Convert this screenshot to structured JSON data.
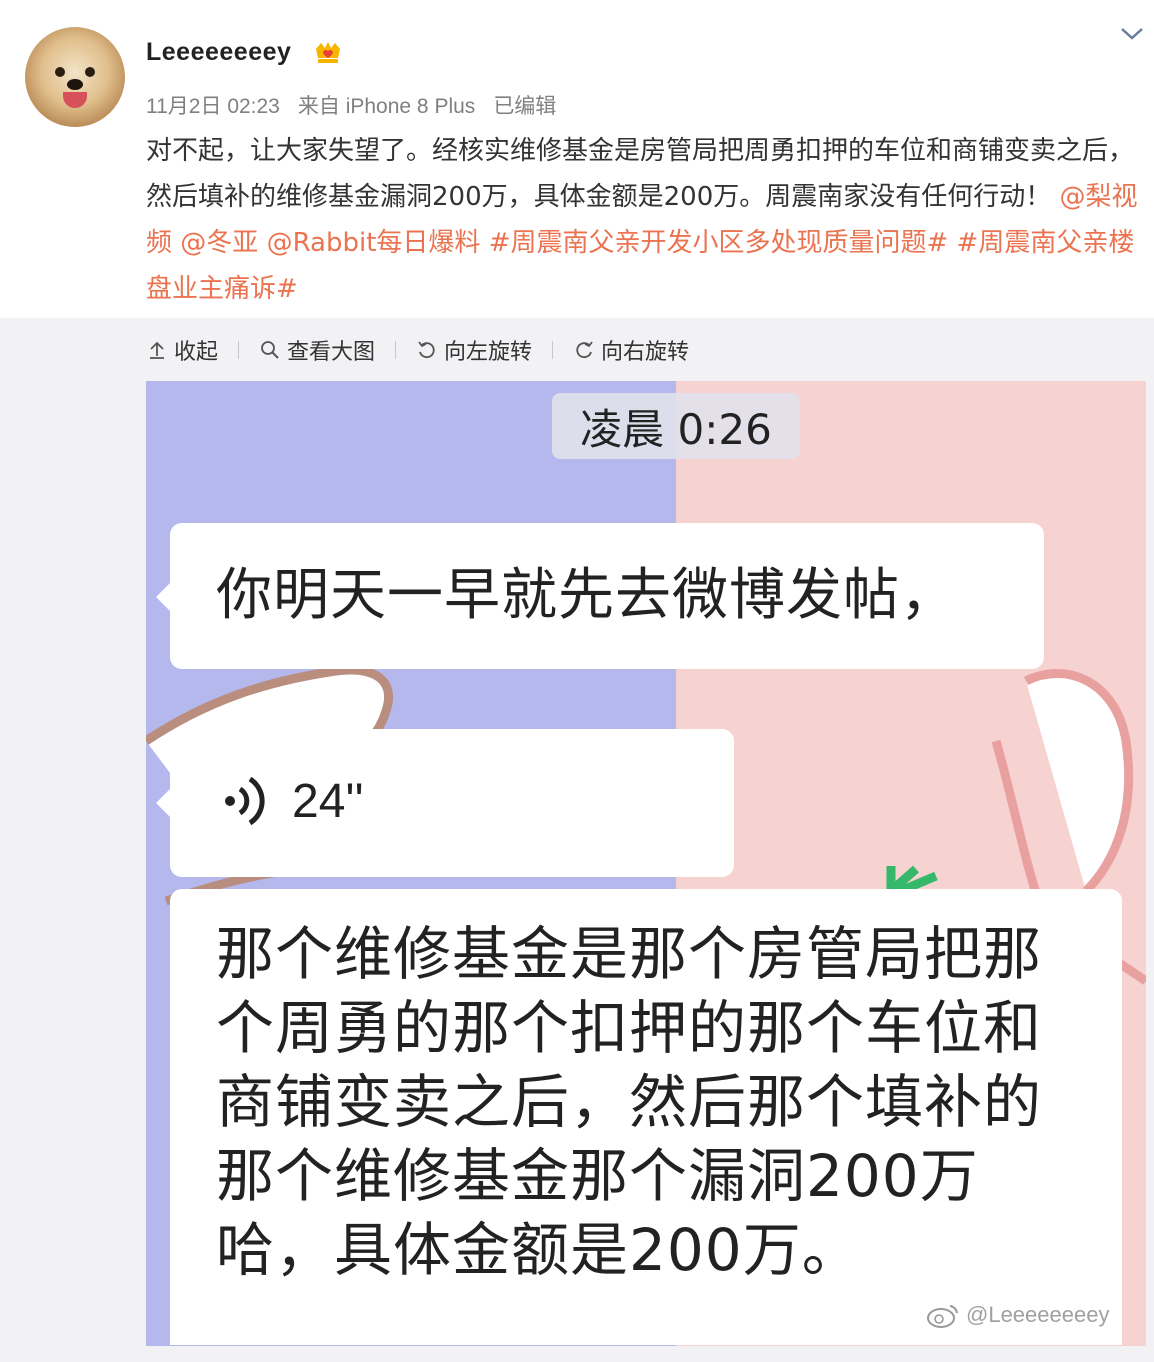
{
  "post": {
    "username": "Leeeeeeeey",
    "meta": {
      "date": "11月2日 02:23",
      "source": "来自 iPhone 8 Plus",
      "edited": "已编辑"
    },
    "text_plain": "对不起，让大家失望了。经核实维修基金是房管局把周勇扣押的车位和商铺变卖之后，然后填补的维修基金漏洞200万，具体金额是200万。周震南家没有任何行动！",
    "mentions": [
      "@梨视频",
      "@冬亚",
      "@Rabbit每日爆料"
    ],
    "topics": [
      "#周震南父亲开发小区多处现质量问题#",
      "#周震南父亲楼盘业主痛诉#"
    ]
  },
  "toolbar": {
    "collapse": "收起",
    "view_large": "查看大图",
    "rotate_left": "向左旋转",
    "rotate_right": "向右旋转"
  },
  "chat": {
    "time": "凌晨 0:26",
    "message_1": "你明天一早就先去微博发帖，",
    "voice_duration": "24''",
    "message_2": "那个维修基金是那个房管局把那个周勇的那个扣押的那个车位和商铺变卖之后，然后那个填补的那个维修基金那个漏洞200万哈，具体金额是200万。"
  },
  "watermark": "@Leeeeeeeey",
  "colors": {
    "link": "#eb7350",
    "chat_left_bg": "#b4b8ec",
    "chat_right_bg": "#f6d3d1"
  },
  "icons": {
    "vip": "crown-heart-badge-icon",
    "expand": "chevron-down-icon",
    "collapse": "arrow-up-icon",
    "view_large": "magnifier-icon",
    "rotate_left": "rotate-left-icon",
    "rotate_right": "rotate-right-icon",
    "voice": "voice-wave-icon",
    "watermark": "weibo-logo-icon"
  }
}
